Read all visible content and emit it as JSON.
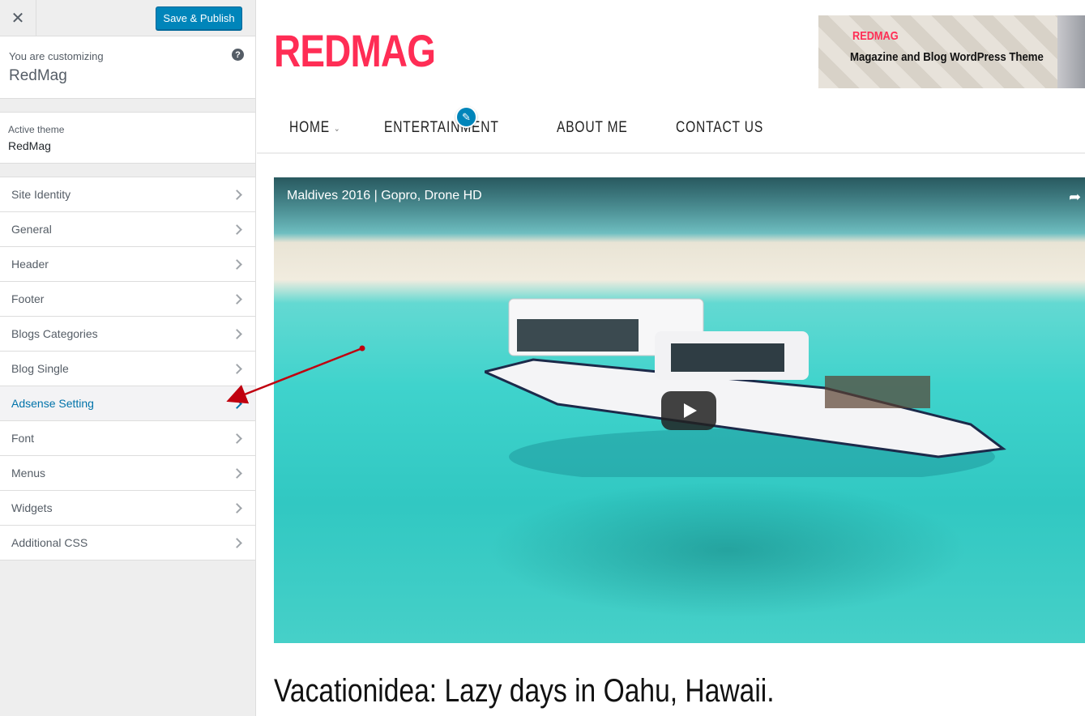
{
  "sidebar": {
    "publish_label": "Save & Publish",
    "customizing_label": "You are customizing",
    "site_name": "RedMag",
    "active_theme_label": "Active theme",
    "active_theme_name": "RedMag",
    "items": [
      {
        "label": "Site Identity"
      },
      {
        "label": "General"
      },
      {
        "label": "Header"
      },
      {
        "label": "Footer"
      },
      {
        "label": "Blogs Categories"
      },
      {
        "label": "Blog Single"
      },
      {
        "label": "Adsense Setting",
        "active": true
      },
      {
        "label": "Font"
      },
      {
        "label": "Menus"
      },
      {
        "label": "Widgets"
      },
      {
        "label": "Additional CSS"
      }
    ]
  },
  "preview": {
    "logo": "REDMAG",
    "ad": {
      "brand": "REDMAG",
      "tagline": "Magazine and Blog WordPress Theme"
    },
    "nav": [
      {
        "label": "HOME",
        "dropdown": true
      },
      {
        "label": "ENTERTAINMENT"
      },
      {
        "label": "ABOUT ME"
      },
      {
        "label": "CONTACT US"
      }
    ],
    "video_title": "Maldives 2016 | Gopro, Drone HD",
    "post_title": "Vacationidea: Lazy days in Oahu, Hawaii."
  },
  "colors": {
    "brand": "#ff2d55",
    "accent": "#0085ba",
    "active_link": "#0073aa",
    "annotation_arrow": "#c0000f"
  },
  "icons": {
    "close": "close-icon",
    "help": "help-icon",
    "chevron": "chevron-right-icon",
    "edit": "pencil-icon",
    "play": "play-icon",
    "share": "share-icon"
  }
}
